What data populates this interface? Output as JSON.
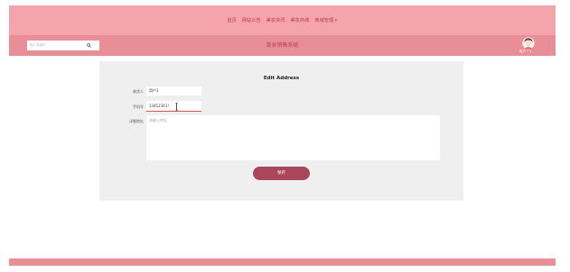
{
  "nav": {
    "items": [
      "首页",
      "网站公告",
      "美妆资讯",
      "美妆商城",
      "商城管理"
    ],
    "dropdown_indicator": "chevron-down-icon"
  },
  "header": {
    "search_placeholder": "输入关键词",
    "site_title": "美妆销售系统",
    "username": "用户一"
  },
  "form": {
    "title": "Edit Address",
    "recipient_label": "收货人",
    "recipient_value": "用户1",
    "phone_label": "手机号",
    "phone_value": "13412341!",
    "address_label": "详细地址",
    "address_placeholder": "请输入地址",
    "save_label": "保存"
  },
  "colors": {
    "nav_bg": "#f5a4ab",
    "header_bg": "#e88e96",
    "accent": "#a8475a",
    "panel_bg": "#efefef"
  }
}
